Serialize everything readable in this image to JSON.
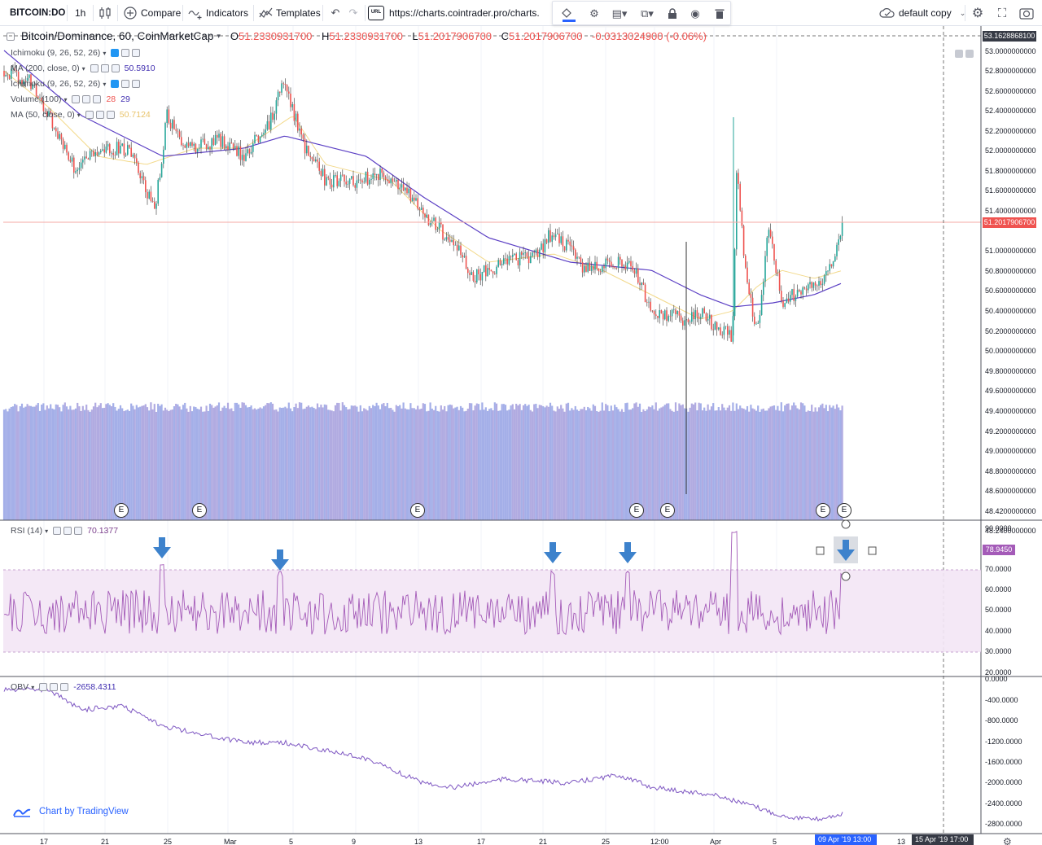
{
  "toolbar": {
    "symbol": "BITCOIN:DO",
    "interval": "1h",
    "compare": "Compare",
    "indicators": "Indicators",
    "templates": "Templates",
    "url": "https://charts.cointrader.pro/charts.",
    "layout_name": "default copy"
  },
  "main_pane": {
    "title": "Bitcoin/Dominance, 60, CoinMarketCap",
    "open": "51.2330931700",
    "high": "51.2330931700",
    "low": "51.2017906700",
    "close": "51.2017906700",
    "change": "-0.0313024900 (-0.06%)",
    "current_price": "51.2017906700",
    "top_price_tag": "53.1628868100",
    "price_axis": [
      "53.0000000000",
      "52.8000000000",
      "52.6000000000",
      "52.4000000000",
      "52.2000000000",
      "52.0000000000",
      "51.8000000000",
      "51.6000000000",
      "51.4000000000",
      "51.0000000000",
      "50.8000000000",
      "50.6000000000",
      "50.4000000000",
      "50.2000000000",
      "50.0000000000",
      "49.8000000000",
      "49.6000000000",
      "49.4000000000",
      "49.2000000000",
      "49.0000000000",
      "48.8000000000",
      "48.6000000000",
      "48.4200000000",
      "48.2400000000"
    ],
    "studies": [
      {
        "name": "Ichimoku (9, 26, 52, 26)",
        "value": ""
      },
      {
        "name": "MA (200, close, 0)",
        "value": "50.5910"
      },
      {
        "name": "Ichimoku (9, 26, 52, 26)",
        "value": ""
      },
      {
        "name": "Volume (100)",
        "value": "28",
        "value2": "29"
      },
      {
        "name": "MA (50, close, 0)",
        "value": "50.7124"
      }
    ],
    "earnings_marker": "E"
  },
  "rsi_pane": {
    "label": "RSI (14)",
    "value": "70.1377",
    "current_tag": "78.9450",
    "axis": [
      "90.0000",
      "70.0000",
      "60.0000",
      "50.0000",
      "40.0000",
      "30.0000",
      "20.0000"
    ]
  },
  "obv_pane": {
    "label": "OBV",
    "value": "-2658.4311",
    "axis": [
      "0.0000",
      "-400.0000",
      "-800.0000",
      "-1200.0000",
      "-1600.0000",
      "-2000.0000",
      "-2400.0000",
      "-2800.0000"
    ]
  },
  "time_axis": {
    "labels": [
      "17",
      "21",
      "25",
      "Mar",
      "5",
      "9",
      "13",
      "17",
      "21",
      "25",
      "12:00",
      "Apr",
      "5"
    ],
    "cursor_tag": "09 Apr '19   13:00",
    "extra_labels": [
      "13"
    ],
    "end_tag": "15 Apr '19   17:00"
  },
  "brand": "Chart by TradingView",
  "colors": {
    "up": "#26a69a",
    "down": "#ef5350",
    "ma200": "#5b3fc4",
    "ma50": "#f3d98a",
    "rsi": "#a45bb8",
    "rsi_band": "#f3e5f5",
    "obv": "#7e57c2",
    "volume": "#8fa2e0",
    "arrow": "#3d82cc"
  }
}
